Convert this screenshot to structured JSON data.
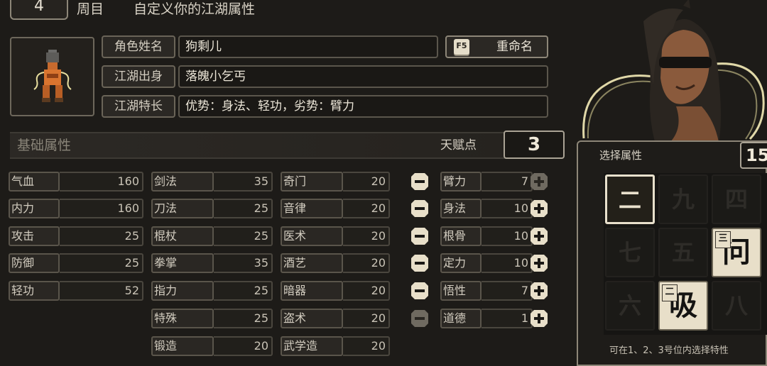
{
  "header": {
    "round_number": "4",
    "round_label": "周目",
    "subtitle": "自定义你的江湖属性"
  },
  "profile": {
    "name_label": "角色姓名",
    "name_value": "狗剩儿",
    "origin_label": "江湖出身",
    "origin_value": "落魄小乞丐",
    "trait_label": "江湖特长",
    "trait_value": "优势：身法、轻功，劣势：臂力",
    "rename_key": "F5",
    "rename_label": "重命名"
  },
  "base": {
    "title": "基础属性",
    "talent_label": "天赋点",
    "talent_points": "3"
  },
  "stats_col1": [
    {
      "label": "气血",
      "value": "160"
    },
    {
      "label": "内力",
      "value": "160"
    },
    {
      "label": "攻击",
      "value": "25"
    },
    {
      "label": "防御",
      "value": "25"
    },
    {
      "label": "轻功",
      "value": "52"
    }
  ],
  "stats_col2": [
    {
      "label": "剑法",
      "value": "35"
    },
    {
      "label": "刀法",
      "value": "25"
    },
    {
      "label": "棍杖",
      "value": "25"
    },
    {
      "label": "拳掌",
      "value": "35"
    },
    {
      "label": "指力",
      "value": "25"
    },
    {
      "label": "特殊",
      "value": "25"
    },
    {
      "label": "锻造",
      "value": "20"
    }
  ],
  "stats_col3": [
    {
      "label": "奇门",
      "value": "20"
    },
    {
      "label": "音律",
      "value": "20"
    },
    {
      "label": "医术",
      "value": "20"
    },
    {
      "label": "酒艺",
      "value": "20"
    },
    {
      "label": "暗器",
      "value": "20"
    },
    {
      "label": "盗术",
      "value": "20"
    },
    {
      "label": "武学造",
      "value": "20"
    }
  ],
  "stats_col4": [
    {
      "label": "臂力",
      "value": "7"
    },
    {
      "label": "身法",
      "value": "10"
    },
    {
      "label": "根骨",
      "value": "10"
    },
    {
      "label": "定力",
      "value": "10"
    },
    {
      "label": "悟性",
      "value": "7"
    },
    {
      "label": "道德",
      "value": "1"
    }
  ],
  "selector": {
    "title": "选择属性",
    "points": "15",
    "tiles": [
      {
        "char": "二",
        "state": "selected"
      },
      {
        "char": "九",
        "state": "dim"
      },
      {
        "char": "四",
        "state": "dim"
      },
      {
        "char": "七",
        "state": "dim"
      },
      {
        "char": "五",
        "state": "dim"
      },
      {
        "char": "问",
        "state": "active",
        "badge": "三"
      },
      {
        "char": "六",
        "state": "dim"
      },
      {
        "char": "吸",
        "state": "active",
        "badge": "二"
      },
      {
        "char": "八",
        "state": "dim"
      }
    ],
    "hint": "可在1、2、3号位内选择特性"
  },
  "colors": {
    "background": "#1d1b18",
    "panel_border": "#8d8678",
    "text": "#d9d3c6",
    "tile_active": "#e8dfc9",
    "minus_disabled": "#8a8478"
  }
}
